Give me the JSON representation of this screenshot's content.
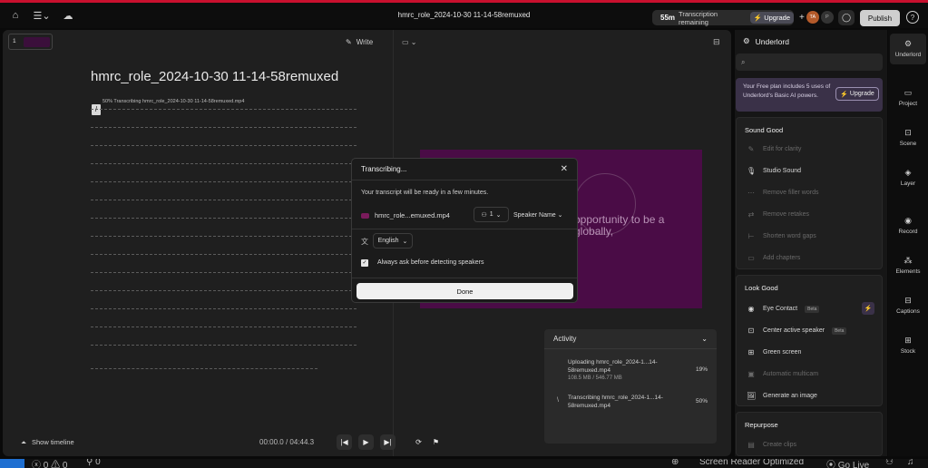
{
  "topbar": {
    "doc_title": "hmrc_role_2024-10-30 11-14-58remuxed",
    "transcription_minutes": "55m",
    "transcription_label": "Transcription remaining",
    "upgrade_label": "Upgrade",
    "avatar1": "TA",
    "avatar2": "P",
    "publish_label": "Publish",
    "help_label": "?"
  },
  "editor": {
    "write_label": "Write",
    "title": "hmrc_role_2024-10-30 11-14-58remuxed",
    "status_line": "50% Transcribing hmrc_role_2024-10-30 11-14-58remuxed.mp4",
    "slash": "/",
    "thumb_number": "1",
    "show_timeline": "Show timeline",
    "time_current": "00:00.0",
    "time_sep": "/",
    "time_total": "04:44.3"
  },
  "canvas": {
    "caption_line1": "opportunity to be a",
    "caption_line2": "globally,"
  },
  "activity": {
    "title": "Activity",
    "items": [
      {
        "title": "Uploading hmrc_role_2024-1...14-58remuxed.mp4",
        "sub": "108.5 MB / 546.77 MB",
        "pct": "19%"
      },
      {
        "title": "Transcribing hmrc_role_2024-1...14-58remuxed.mp4",
        "sub": "",
        "pct": "50%"
      }
    ]
  },
  "modal": {
    "title": "Transcribing...",
    "description": "Your transcript will be ready in a few minutes.",
    "file_name": "hmrc_role...emuxed.mp4",
    "speaker_count": "1",
    "speaker_name": "Speaker Name",
    "language": "English",
    "checkbox_label": "Always ask before detecting speakers",
    "done_label": "Done"
  },
  "underlord": {
    "title": "Underlord",
    "free_plan_text": "Your Free plan includes 5 uses of Underlord's Basic AI powers.",
    "upgrade_label": "Upgrade",
    "sound_good": {
      "heading": "Sound Good",
      "items": [
        "Edit for clarity",
        "Studio Sound",
        "Remove filler words",
        "Remove retakes",
        "Shorten word gaps",
        "Add chapters"
      ]
    },
    "look_good": {
      "heading": "Look Good",
      "items": [
        "Eye Contact",
        "Center active speaker",
        "Green screen",
        "Automatic multicam",
        "Generate an image"
      ],
      "beta": "Beta"
    },
    "repurpose": {
      "heading": "Repurpose",
      "items": [
        "Create clips"
      ]
    }
  },
  "rail": [
    "Underlord",
    "Project",
    "Scene",
    "Layer",
    "Record",
    "Elements",
    "Captions",
    "Stock"
  ],
  "statusbar": {
    "errors": "0",
    "warnings": "0",
    "ports": "0",
    "screen_reader": "Screen Reader Optimized",
    "go_live": "Go Live"
  }
}
